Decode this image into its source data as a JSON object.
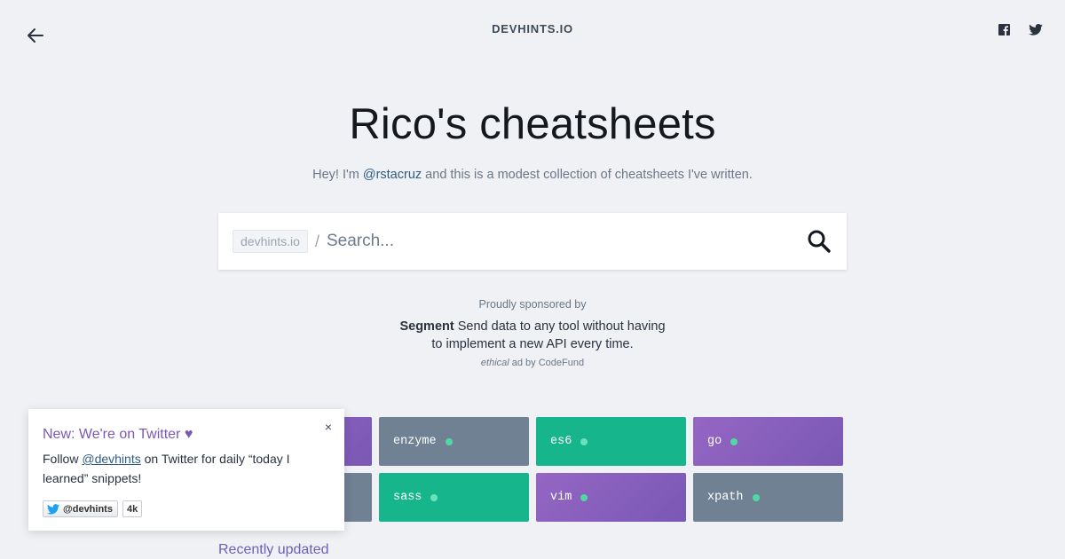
{
  "header": {
    "brand": "DEVHINTS.IO",
    "back_icon": "arrow-left-icon",
    "social": [
      "facebook-icon",
      "twitter-icon"
    ]
  },
  "hero": {
    "title": "Rico's cheatsheets",
    "sub_before": "Hey! I'm ",
    "sub_link": "@rstacruz",
    "sub_after": " and this is a modest collection of cheatsheets I've written."
  },
  "search": {
    "prefix": "devhints.io",
    "slash": "/",
    "placeholder": "Search..."
  },
  "sponsor": {
    "label": "Proudly sponsored by",
    "name": "Segment",
    "text": " Send data to any tool without having to implement a new API every time.",
    "via_italic": "ethical",
    "via_rest": " ad by CodeFund"
  },
  "tiles": [
    {
      "label": "enzyme",
      "color": "gray"
    },
    {
      "label": "es6",
      "color": "green"
    },
    {
      "label": "go",
      "color": "purple"
    },
    {
      "label": "sass",
      "color": "green"
    },
    {
      "label": "vim",
      "color": "purple"
    },
    {
      "label": "xpath",
      "color": "gray"
    }
  ],
  "recent": "Recently updated",
  "popup": {
    "title": "New: We're on Twitter ♥",
    "body_before": "Follow ",
    "body_link": "@devhints",
    "body_after": " on Twitter for daily “today I learned” snippets!",
    "close": "×",
    "follow_label": "@devhints",
    "follow_count": "4k"
  },
  "colors": {
    "accent_purple": "#7a58b5",
    "tile_green": "#17b58b",
    "tile_gray": "#708193",
    "dot_green": "#4fd8a2"
  }
}
